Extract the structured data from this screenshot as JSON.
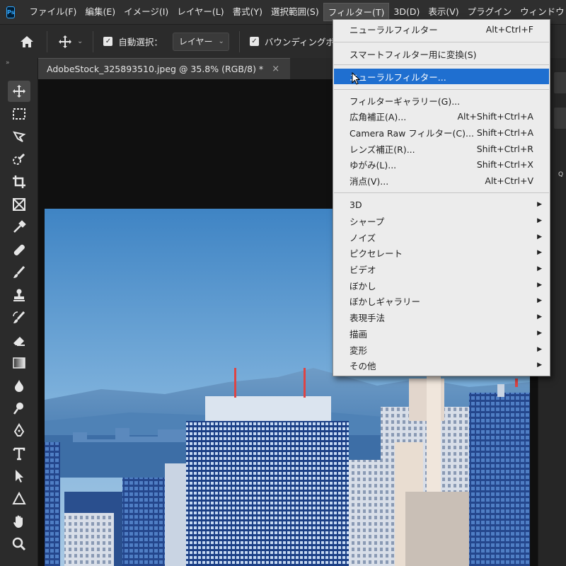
{
  "app": {
    "logo": "Ps"
  },
  "menubar": {
    "items": [
      "ファイル(F)",
      "編集(E)",
      "イメージ(I)",
      "レイヤー(L)",
      "書式(Y)",
      "選択範囲(S)",
      "フィルター(T)",
      "3D(D)",
      "表示(V)",
      "プラグイン",
      "ウィンドウ"
    ],
    "active_index": 6
  },
  "options": {
    "auto_select_label": "自動選択：",
    "auto_select_checked": true,
    "layer_select_value": "レイヤー",
    "bounding_box_label": "バウンディングボ",
    "bounding_box_checked": true
  },
  "document_tab": {
    "title": "AdobeStock_325893510.jpeg @ 35.8% (RGB/8) *",
    "close": "×"
  },
  "filter_menu": {
    "items": [
      {
        "label": "ニューラルフィルター",
        "shortcut": "Alt+Ctrl+F"
      },
      {
        "label": "スマートフィルター用に変換(S)",
        "shortcut": ""
      },
      {
        "label": "ニューラルフィルター...",
        "shortcut": "",
        "highlighted": true
      },
      {
        "label": "フィルターギャラリー(G)...",
        "shortcut": ""
      },
      {
        "label": "広角補正(A)...",
        "shortcut": "Alt+Shift+Ctrl+A"
      },
      {
        "label": "Camera Raw フィルター(C)...",
        "shortcut": "Shift+Ctrl+A"
      },
      {
        "label": "レンズ補正(R)...",
        "shortcut": "Shift+Ctrl+R"
      },
      {
        "label": "ゆがみ(L)...",
        "shortcut": "Shift+Ctrl+X"
      },
      {
        "label": "消点(V)...",
        "shortcut": "Alt+Ctrl+V"
      },
      {
        "label": "3D",
        "submenu": true
      },
      {
        "label": "シャープ",
        "submenu": true
      },
      {
        "label": "ノイズ",
        "submenu": true
      },
      {
        "label": "ピクセレート",
        "submenu": true
      },
      {
        "label": "ビデオ",
        "submenu": true
      },
      {
        "label": "ぼかし",
        "submenu": true
      },
      {
        "label": "ぼかしギャラリー",
        "submenu": true
      },
      {
        "label": "表現手法",
        "submenu": true
      },
      {
        "label": "描画",
        "submenu": true
      },
      {
        "label": "変形",
        "submenu": true
      },
      {
        "label": "その他",
        "submenu": true
      }
    ],
    "submenu_arrow": "▶"
  },
  "right_dock": {
    "label": "Q"
  },
  "colors": {
    "highlight": "#1f6fd0",
    "menu_bg": "#ececec",
    "app_bg": "#2b2b2b",
    "ps_blue": "#31a8ff"
  }
}
